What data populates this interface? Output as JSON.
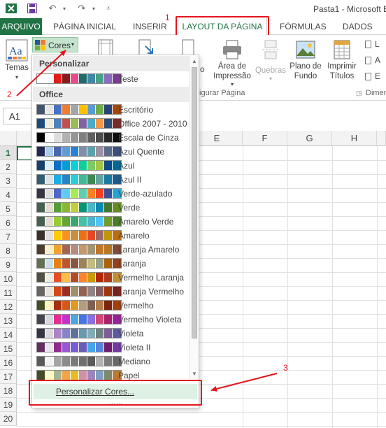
{
  "window": {
    "title": "Pasta1 - Microsoft E"
  },
  "tabs": {
    "file": "ARQUIVO",
    "items": [
      "PÁGINA INICIAL",
      "INSERIR",
      "LAYOUT DA PÁGINA",
      "FÓRMULAS",
      "DADOS"
    ],
    "active": "LAYOUT DA PÁGINA"
  },
  "ribbon": {
    "themes": "Temas",
    "colors": "Cores",
    "fonts_partial": "o",
    "print_area_line1": "Área de",
    "print_area_line2": "Impressão",
    "breaks": "Quebras",
    "background_line1": "Plano de",
    "background_line2": "Fundo",
    "print_titles_line1": "Imprimir",
    "print_titles_line2": "Títulos",
    "right_l": "L",
    "right_a": "A",
    "right_e": "E",
    "group_page_setup": "figurar Página",
    "group_scale": "Dimen"
  },
  "formula_bar": {
    "name_box": "A1"
  },
  "sheet": {
    "columns_visible": [
      "E",
      "F",
      "G",
      "H"
    ],
    "rows": [
      "1",
      "2",
      "3",
      "4",
      "5",
      "6",
      "7",
      "8",
      "9",
      "10",
      "11",
      "12",
      "13",
      "14",
      "15",
      "16",
      "17",
      "18",
      "19",
      "20"
    ]
  },
  "annotations": {
    "num1": "1",
    "num2": "2",
    "num3": "3",
    "color": "#e5141d"
  },
  "dropdown": {
    "custom_header": "Personalizar",
    "custom_themes": [
      {
        "name": "Teste",
        "colors": [
          "#ffffff",
          "#ffffff",
          "#e41b17",
          "#8b1a1a",
          "#e84a8a",
          "#1f6b6b",
          "#3f87a6",
          "#4aa085",
          "#8a6bbf",
          "#7a3c8c"
        ]
      }
    ],
    "office_header": "Office",
    "themes": [
      {
        "name": "Escritório",
        "colors": [
          "#44546a",
          "#e7e6e6",
          "#4472c4",
          "#ed7d31",
          "#a5a5a5",
          "#ffc000",
          "#5b9bd5",
          "#70ad47",
          "#264478",
          "#9e480e"
        ]
      },
      {
        "name": "Office 2007 - 2010",
        "colors": [
          "#1f497d",
          "#eeece1",
          "#4f81bd",
          "#c0504d",
          "#9bbb59",
          "#8064a2",
          "#4bacc6",
          "#f79646",
          "#2c4d75",
          "#772c2a"
        ]
      },
      {
        "name": "Escala de Cinza",
        "colors": [
          "#000000",
          "#f8f8f8",
          "#dddddd",
          "#b2b2b2",
          "#969696",
          "#808080",
          "#5f5f5f",
          "#4d4d4d",
          "#292929",
          "#0f0f0f"
        ]
      },
      {
        "name": "Azul Quente",
        "colors": [
          "#242852",
          "#acccea",
          "#4a66ac",
          "#629dd1",
          "#297fd5",
          "#7f8fa9",
          "#5aa2ae",
          "#9d90a0",
          "#5b6b8a",
          "#3b4f7a"
        ]
      },
      {
        "name": "Azul",
        "colors": [
          "#17406d",
          "#dbefff",
          "#0f6fc6",
          "#009dd9",
          "#0bd0d9",
          "#10cf9b",
          "#7cca62",
          "#a5c249",
          "#0a4a85",
          "#006a94"
        ]
      },
      {
        "name": "Azul II",
        "colors": [
          "#335b74",
          "#dfe3e5",
          "#1cade4",
          "#2683c6",
          "#27ced7",
          "#42ba97",
          "#3e8853",
          "#62a39f",
          "#1a7aa1",
          "#1b5b8c"
        ]
      },
      {
        "name": "Verde-azulado",
        "colors": [
          "#373545",
          "#dedede",
          "#4e67c8",
          "#5eccf3",
          "#a7ea52",
          "#5dceaf",
          "#ff8021",
          "#f14124",
          "#3a4d96",
          "#2aa2cf"
        ]
      },
      {
        "name": "Verde",
        "colors": [
          "#455f51",
          "#e3ded1",
          "#549e39",
          "#8ab833",
          "#c0cf3a",
          "#029676",
          "#4ab5c4",
          "#0989b1",
          "#3f7629",
          "#678a26"
        ]
      },
      {
        "name": "Amarelo Verde",
        "colors": [
          "#455f51",
          "#e3ded1",
          "#99cb38",
          "#63a537",
          "#37a76f",
          "#44c1a3",
          "#4eb3cf",
          "#51c3f9",
          "#739a2a",
          "#4a7c29"
        ]
      },
      {
        "name": "Amarelo",
        "colors": [
          "#39302a",
          "#e5dedb",
          "#ffca08",
          "#f8931d",
          "#ce8d3e",
          "#ec7016",
          "#e64823",
          "#9c6a6a",
          "#bf9706",
          "#ba6d15"
        ]
      },
      {
        "name": "Laranja Amarelo",
        "colors": [
          "#4e3b30",
          "#fbeec9",
          "#f0a22e",
          "#a5644e",
          "#b58b80",
          "#c3986d",
          "#a19574",
          "#c17529",
          "#b47922",
          "#7c4b3a"
        ]
      },
      {
        "name": "Laranja",
        "colors": [
          "#637052",
          "#ccddea",
          "#e48312",
          "#bd582c",
          "#865640",
          "#9b8357",
          "#c2bc80",
          "#94a088",
          "#ab620d",
          "#8d4221"
        ]
      },
      {
        "name": "Vermelho Laranja",
        "colors": [
          "#505046",
          "#eeece1",
          "#e84c22",
          "#ffbd47",
          "#b64926",
          "#ff8427",
          "#cc9900",
          "#b22600",
          "#ae3919",
          "#bf8e35"
        ]
      },
      {
        "name": "Laranja Vermelho",
        "colors": [
          "#696464",
          "#e9e5dc",
          "#d34817",
          "#9b2d1f",
          "#a28e6a",
          "#956251",
          "#918485",
          "#855d5d",
          "#9e3611",
          "#74221f"
        ]
      },
      {
        "name": "Vermelho",
        "colors": [
          "#444d26",
          "#fef2c1",
          "#a5300f",
          "#d55816",
          "#e19825",
          "#b19c7d",
          "#7f5f52",
          "#b27d49",
          "#7b240b",
          "#a04210"
        ]
      },
      {
        "name": "Vermelho Violeta",
        "colors": [
          "#454551",
          "#d8d9dc",
          "#e32d91",
          "#c830cc",
          "#4ea6dc",
          "#4775e7",
          "#8971e1",
          "#d54773",
          "#aa226d",
          "#962499"
        ]
      },
      {
        "name": "Violeta",
        "colors": [
          "#373545",
          "#dcd8dc",
          "#ad84c6",
          "#8784c7",
          "#5d739a",
          "#6997af",
          "#84acb6",
          "#6f8183",
          "#7f5c94",
          "#5d5b9b"
        ]
      },
      {
        "name": "Violeta II",
        "colors": [
          "#632e62",
          "#eae5eb",
          "#92278f",
          "#9b57d3",
          "#755dd9",
          "#665eb8",
          "#45a5ed",
          "#5982db",
          "#6d1d6b",
          "#7339a3"
        ]
      },
      {
        "name": "Mediano",
        "colors": [
          "#595959",
          "#f2f2f2",
          "#a5a5a5",
          "#8c8c8c",
          "#7b7b7b",
          "#6f6f6f",
          "#5a5a5a",
          "#b1b1b1",
          "#7c7c7c",
          "#696969"
        ]
      },
      {
        "name": "Papel",
        "colors": [
          "#444d26",
          "#fefac9",
          "#a5b592",
          "#f3a447",
          "#e7bc29",
          "#d092a7",
          "#9c85c0",
          "#809ec2",
          "#7b8a6d",
          "#b67a35"
        ]
      }
    ],
    "custom_link": "Personalizar Cores..."
  }
}
